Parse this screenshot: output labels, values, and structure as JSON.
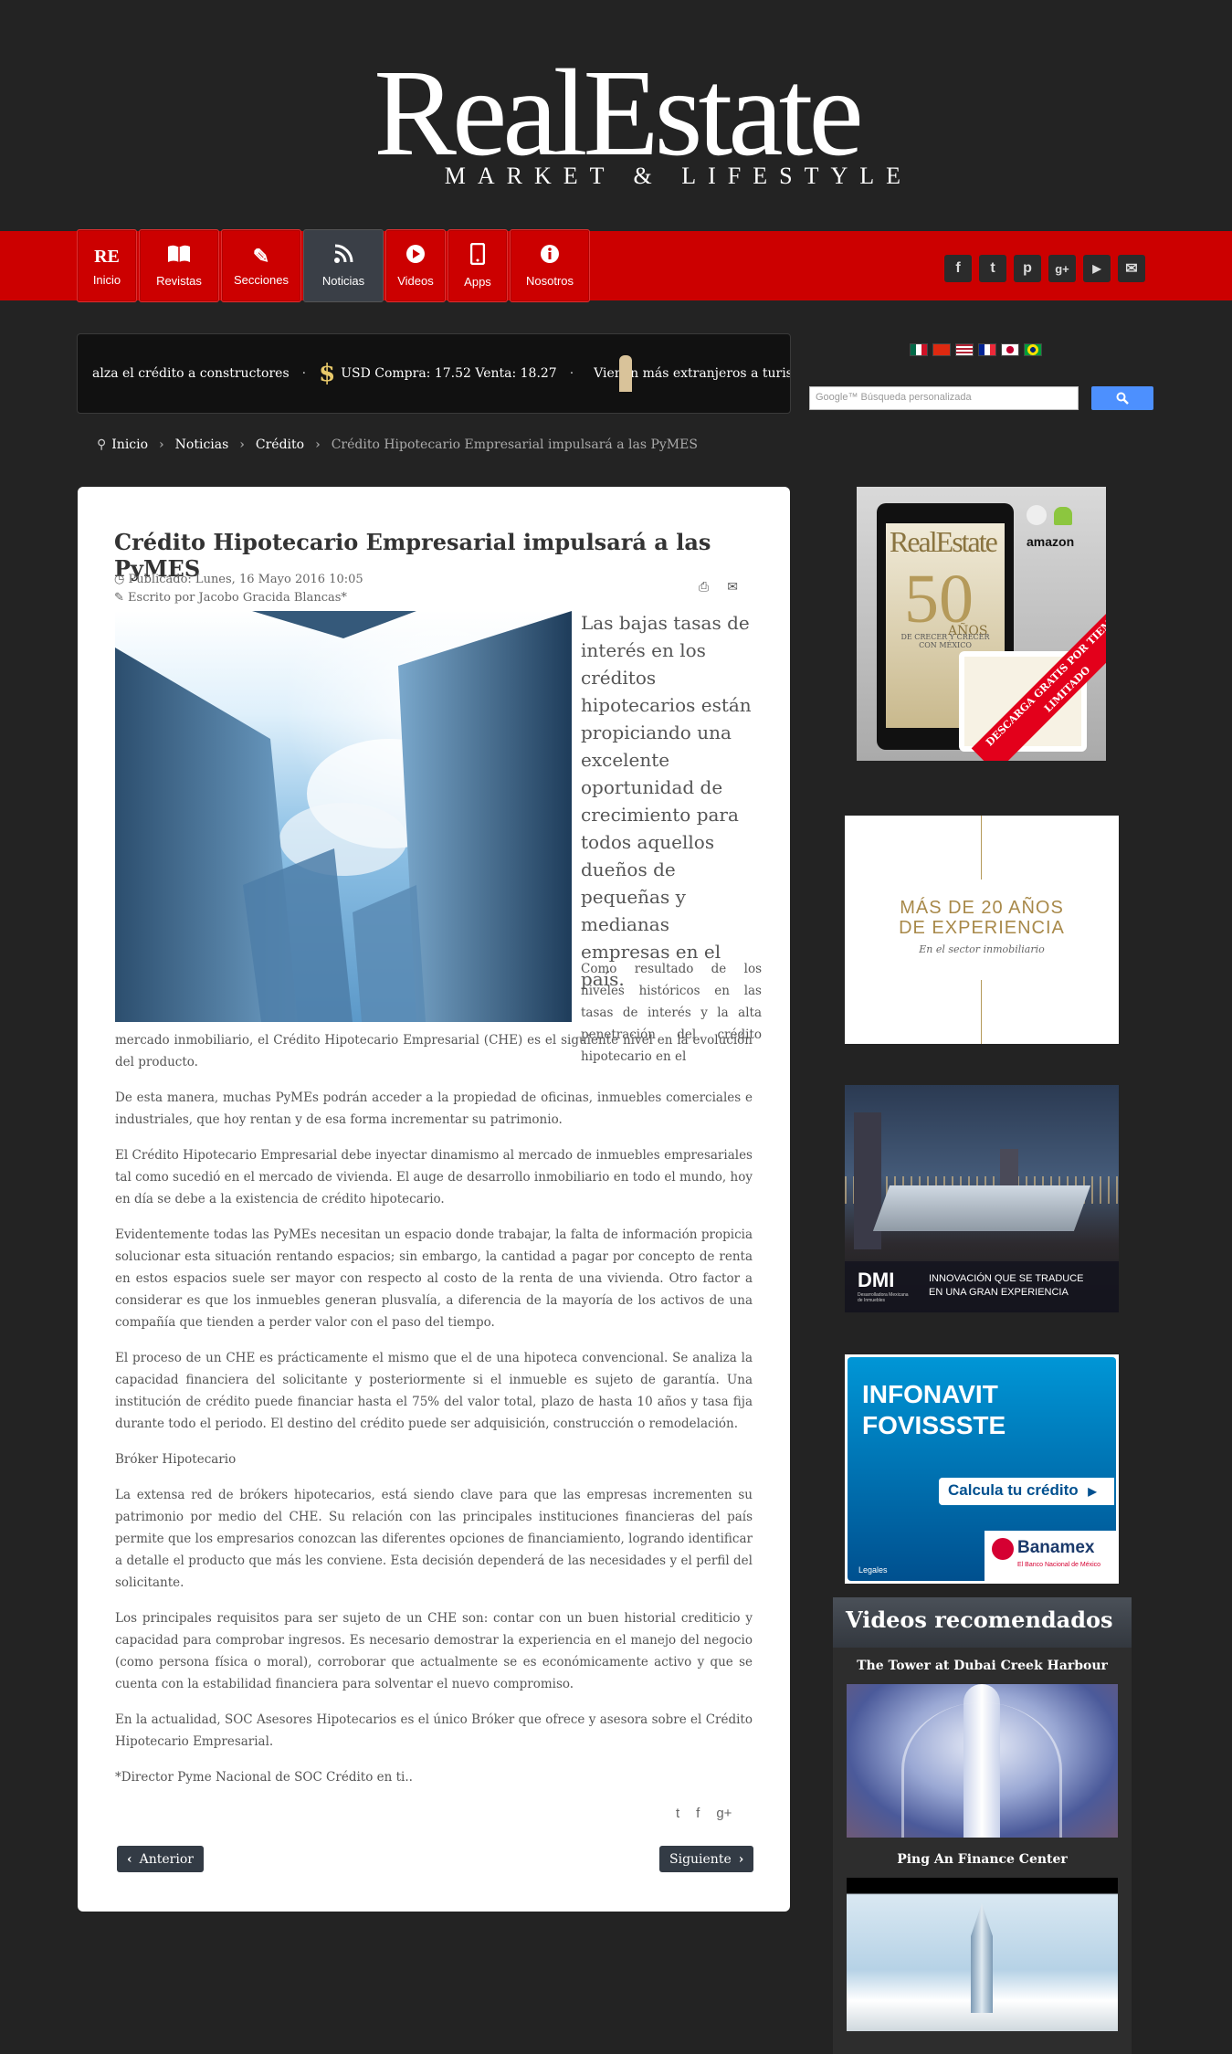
{
  "logo": {
    "main": "RealEstate",
    "sub": "MARKET & LIFESTYLE"
  },
  "nav": [
    {
      "label": "Inicio",
      "icon": "re-logo-icon",
      "glyph": "RE"
    },
    {
      "label": "Revistas",
      "icon": "book-icon",
      "glyph": "📖"
    },
    {
      "label": "Secciones",
      "icon": "pencil-icon",
      "glyph": "✎"
    },
    {
      "label": "Noticias",
      "icon": "rss-icon",
      "glyph": "◔"
    },
    {
      "label": "Videos",
      "icon": "play-icon",
      "glyph": "▶"
    },
    {
      "label": "Apps",
      "icon": "mobile-icon",
      "glyph": "▯"
    },
    {
      "label": "Nosotros",
      "icon": "info-icon",
      "glyph": "ℹ"
    }
  ],
  "social": [
    {
      "icon": "facebook-icon",
      "glyph": "f"
    },
    {
      "icon": "twitter-icon",
      "glyph": "t"
    },
    {
      "icon": "pinterest-icon",
      "glyph": "p"
    },
    {
      "icon": "googleplus-icon",
      "glyph": "g+"
    },
    {
      "icon": "youtube-icon",
      "glyph": "▶"
    },
    {
      "icon": "mail-icon",
      "glyph": "✉"
    }
  ],
  "ticker": {
    "item1": "alza el crédito a constructores",
    "usd": "USD Compra: 17.52 Venta: 18.27",
    "item2": "Vienen más extranjeros a turiste"
  },
  "search": {
    "placeholder": "Google™ Búsqueda personalizada"
  },
  "breadcrumb": {
    "home": "Inicio",
    "noticias": "Noticias",
    "credito": "Crédito",
    "current": "Crédito Hipotecario Empresarial impulsará a las PyMES"
  },
  "article": {
    "title": "Crédito Hipotecario Empresarial impulsará a las PyMES",
    "published": "Publicado: Lunes, 16 Mayo 2016 10:05",
    "author": "Escrito por Jacobo Gracida Blancas*",
    "lead": "Las bajas tasas de interés en los créditos hipotecarios están propiciando una excelente oportunidad de crecimiento para todos aquellos dueños de pequeñas y medianas empresas en el país.",
    "p1a": "Como resultado de los niveles históricos en las tasas de interés y la alta penetración del crédito hipotecario en el",
    "p1b": "mercado inmobiliario, el Crédito Hipotecario Empresarial (CHE) es el siguiente nivel en la evolución del producto.",
    "p2": "De esta manera, muchas PyMEs podrán acceder a la propiedad de oficinas, inmuebles comerciales e industriales, que hoy rentan y de esa forma incrementar su patrimonio.",
    "p3": "El Crédito Hipotecario Empresarial debe inyectar dinamismo al mercado de inmuebles empresariales tal como sucedió en el mercado de vivienda. El auge de desarrollo inmobiliario en todo el mundo, hoy en día se debe a la existencia de crédito hipotecario.",
    "p4": "Evidentemente todas las PyMEs necesitan un espacio donde trabajar, la falta de información propicia solucionar esta situación rentando espacios; sin embargo, la cantidad a pagar por concepto de renta en estos espacios suele ser mayor con respecto al costo de la renta de una vivienda. Otro factor a considerar es que los inmuebles generan plusvalía, a diferencia de la mayoría de los activos de una compañía que tienden a perder valor con el paso del tiempo.",
    "p5": "El proceso de un CHE es prácticamente el mismo que el de una hipoteca convencional. Se analiza la capacidad financiera del solicitante y posteriormente si el inmueble es sujeto de garantía. Una institución de crédito puede financiar hasta el 75% del valor total, plazo de hasta 10 años y tasa fija durante todo el periodo. El destino del crédito puede ser adquisición, construcción o remodelación.",
    "p6": "Bróker Hipotecario",
    "p7": "La extensa red de brókers hipotecarios, está siendo clave para que las empresas incrementen su patrimonio por medio del CHE. Su relación con las principales instituciones financieras del país permite que los empresarios conozcan las diferentes opciones de financiamiento, logrando identificar a detalle el producto que más les conviene. Esta decisión dependerá de las necesidades y el perfil del solicitante.",
    "p8": "Los principales requisitos para ser sujeto de un CHE son: contar con un buen historial crediticio y capacidad para comprobar ingresos. Es necesario demostrar la experiencia en el manejo del negocio (como persona física o moral), corroborar que actualmente se es económicamente activo y que se cuenta con la estabilidad financiera para solventar el nuevo compromiso.",
    "p9": "En la actualidad, SOC Asesores Hipotecarios es el único Bróker que ofrece y asesora sobre el Crédito Hipotecario Empresarial.",
    "p10": "*Director Pyme Nacional de SOC Crédito en ti..",
    "prev": "Anterior",
    "next": "Siguiente"
  },
  "ads": {
    "ad1": {
      "logo": "RealEstate",
      "years": "50",
      "anos": "AÑOS",
      "tagline": "DE CRECER Y CRECER CON MÉXICO",
      "amazon": "amazon",
      "ribbon": "DESCARGA GRATIS POR TIEMPO LIMITADO"
    },
    "ad2": {
      "line1": "MÁS DE 20 AÑOS",
      "line2": "DE EXPERIENCIA",
      "sub": "En el sector inmobiliario"
    },
    "ad3": {
      "brand": "DMI",
      "brand_sub": "Desarrolladora Mexicana de Inmuebles",
      "line1": "INNOVACIÓN QUE SE TRADUCE",
      "line2": "EN UNA GRAN EXPERIENCIA"
    },
    "ad4": {
      "line1": "INFONAVIT",
      "line2": "FOVISSSTE",
      "cta": "Calcula tu crédito",
      "bank": "Banamex",
      "bank_sub": "El Banco Nacional de México",
      "legal": "Legales"
    }
  },
  "videos": {
    "heading": "Videos recomendados",
    "items": [
      {
        "title": "The Tower at Dubai Creek Harbour"
      },
      {
        "title": "Ping An Finance Center"
      }
    ]
  },
  "colors": {
    "nav_red": "#cc0000",
    "active_nav": "#3a3f47",
    "background": "#232323"
  }
}
